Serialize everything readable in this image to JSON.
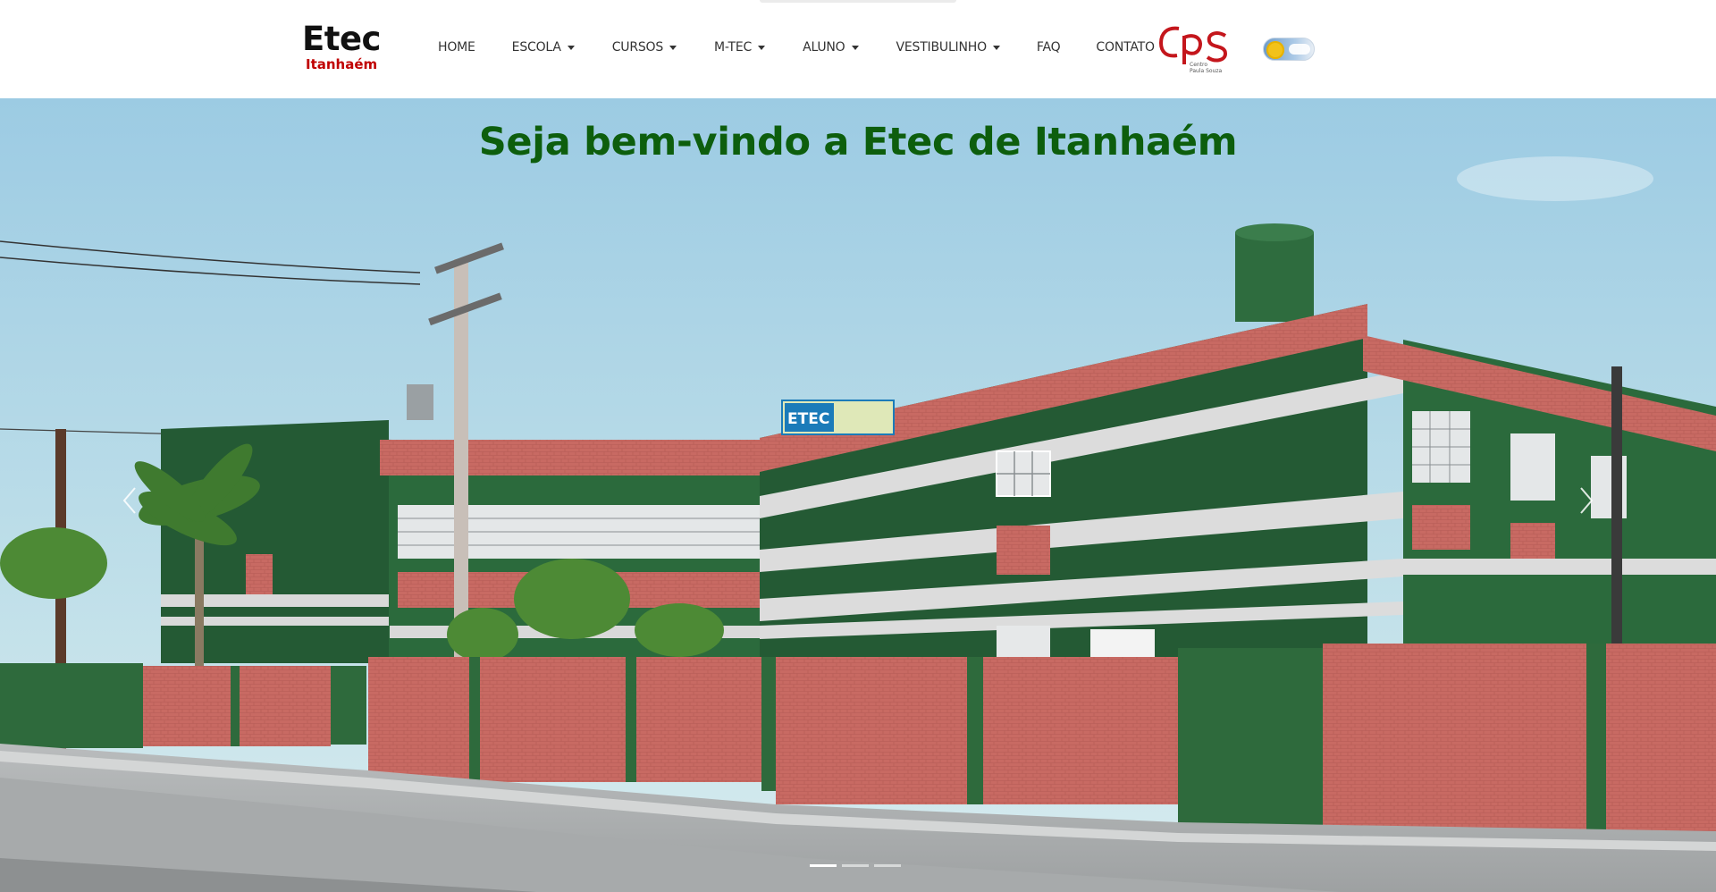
{
  "brand": {
    "name": "Etec",
    "campus": "Itanhaém"
  },
  "nav": {
    "items": [
      {
        "label": "HOME",
        "dropdown": false
      },
      {
        "label": "ESCOLA",
        "dropdown": true
      },
      {
        "label": "CURSOS",
        "dropdown": true
      },
      {
        "label": "M-TEC",
        "dropdown": true
      },
      {
        "label": "ALUNO",
        "dropdown": true
      },
      {
        "label": "VESTIBULINHO",
        "dropdown": true
      },
      {
        "label": "FAQ",
        "dropdown": false
      },
      {
        "label": "CONTATO",
        "dropdown": false
      }
    ]
  },
  "partner_logo": {
    "mark": "cps",
    "line1": "Centro",
    "line2": "Paula Souza",
    "color": "#c4161c"
  },
  "theme_toggle": {
    "mode": "light"
  },
  "hero": {
    "title": "Seja bem-vindo a Etec de Itanhaém",
    "sign_text": "ETEC",
    "slides": 3,
    "active_slide": 1
  },
  "colors": {
    "title_green": "#0d5e0d",
    "building_green": "#245a34",
    "brick": "#c86a63",
    "brand_red": "#c00000"
  },
  "icons": {
    "prev": "chevron-left-icon",
    "next": "chevron-right-icon",
    "dropdown": "caret-down-icon"
  }
}
